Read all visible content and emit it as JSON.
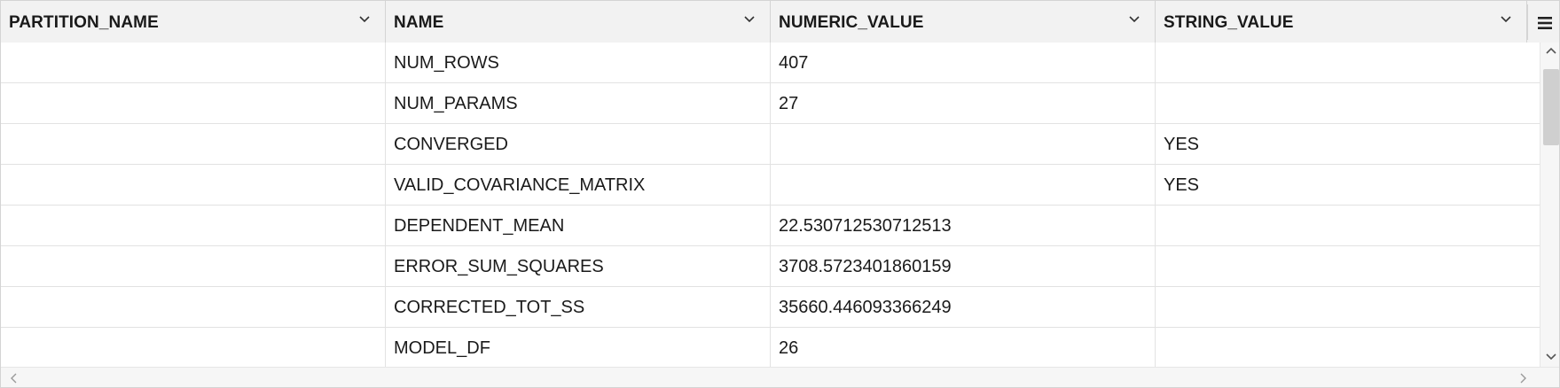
{
  "columns": [
    {
      "label": "PARTITION_NAME"
    },
    {
      "label": "NAME"
    },
    {
      "label": "NUMERIC_VALUE"
    },
    {
      "label": "STRING_VALUE"
    }
  ],
  "rows": [
    {
      "partition_name": "",
      "name": "NUM_ROWS",
      "numeric_value": "407",
      "string_value": ""
    },
    {
      "partition_name": "",
      "name": "NUM_PARAMS",
      "numeric_value": "27",
      "string_value": ""
    },
    {
      "partition_name": "",
      "name": "CONVERGED",
      "numeric_value": "",
      "string_value": "YES"
    },
    {
      "partition_name": "",
      "name": "VALID_COVARIANCE_MATRIX",
      "numeric_value": "",
      "string_value": "YES"
    },
    {
      "partition_name": "",
      "name": "DEPENDENT_MEAN",
      "numeric_value": "22.530712530712513",
      "string_value": ""
    },
    {
      "partition_name": "",
      "name": "ERROR_SUM_SQUARES",
      "numeric_value": "3708.5723401860159",
      "string_value": ""
    },
    {
      "partition_name": "",
      "name": "CORRECTED_TOT_SS",
      "numeric_value": "35660.446093366249",
      "string_value": ""
    },
    {
      "partition_name": "",
      "name": "MODEL_DF",
      "numeric_value": "26",
      "string_value": ""
    }
  ],
  "icons": {
    "column_menu": "chevron-down-icon",
    "grid_menu": "hamburger-menu-icon",
    "scroll_up": "arrow-up-icon",
    "scroll_down": "arrow-down-icon",
    "scroll_left": "arrow-left-icon",
    "scroll_right": "arrow-right-icon"
  },
  "colors": {
    "header_bg": "#f2f2f2",
    "border": "#d4d4d4",
    "scroll_thumb": "#cfcfcf"
  }
}
